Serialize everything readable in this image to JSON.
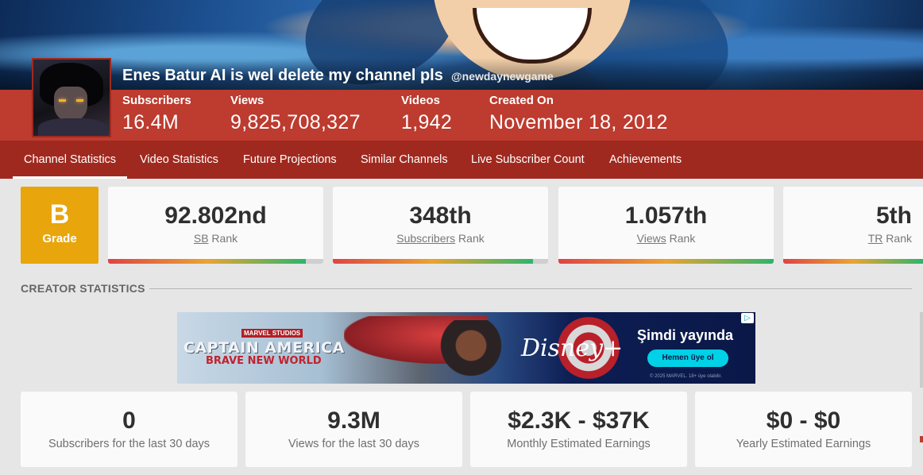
{
  "channel": {
    "name": "Enes Batur AI is wel delete my channel pls",
    "handle": "@newdaynewgame"
  },
  "header_stats": [
    {
      "label": "Subscribers",
      "value": "16.4M"
    },
    {
      "label": "Views",
      "value": "9,825,708,327"
    },
    {
      "label": "Videos",
      "value": "1,942"
    },
    {
      "label": "Created On",
      "value": "November 18, 2012"
    }
  ],
  "tabs": [
    {
      "label": "Channel Statistics",
      "active": true
    },
    {
      "label": "Video Statistics"
    },
    {
      "label": "Future Projections"
    },
    {
      "label": "Similar Channels"
    },
    {
      "label": "Live Subscriber Count"
    },
    {
      "label": "Achievements"
    }
  ],
  "grade": {
    "letter": "B",
    "label": "Grade",
    "color": "#e8a50c"
  },
  "ranks": [
    {
      "value": "92.802nd",
      "abbr": "SB",
      "suffix": " Rank",
      "level": 0.92
    },
    {
      "value": "348th",
      "abbr": "Subscribers",
      "suffix": " Rank",
      "level": 0.93
    },
    {
      "value": "1.057th",
      "abbr": "Views",
      "suffix": " Rank",
      "level": 1.0
    },
    {
      "value": "5th",
      "abbr": "TR",
      "suffix": " Rank",
      "level": 1.0
    }
  ],
  "section": {
    "title": "CREATOR STATISTICS"
  },
  "ad": {
    "studio": "MARVEL STUDIOS",
    "title": "CAPTAIN AMERICA",
    "subtitle": "BRAVE NEW WORLD",
    "brand": "Disney+",
    "headline": "Şimdi yayında",
    "button": "Hemen üye ol",
    "legal": "© 2025 MARVEL. 18+ üye olabilir."
  },
  "metrics": [
    {
      "value": "0",
      "label": "Subscribers for the last 30 days"
    },
    {
      "value": "9.3M",
      "label": "Views for the last 30 days"
    },
    {
      "value": "$2.3K - $37K",
      "label": "Monthly Estimated Earnings"
    },
    {
      "value": "$0 - $0",
      "label": "Yearly Estimated Earnings"
    }
  ],
  "colors": {
    "header_red": "#bd3b2f",
    "tab_red": "#a0291f",
    "grade_orange": "#e8a50c"
  }
}
